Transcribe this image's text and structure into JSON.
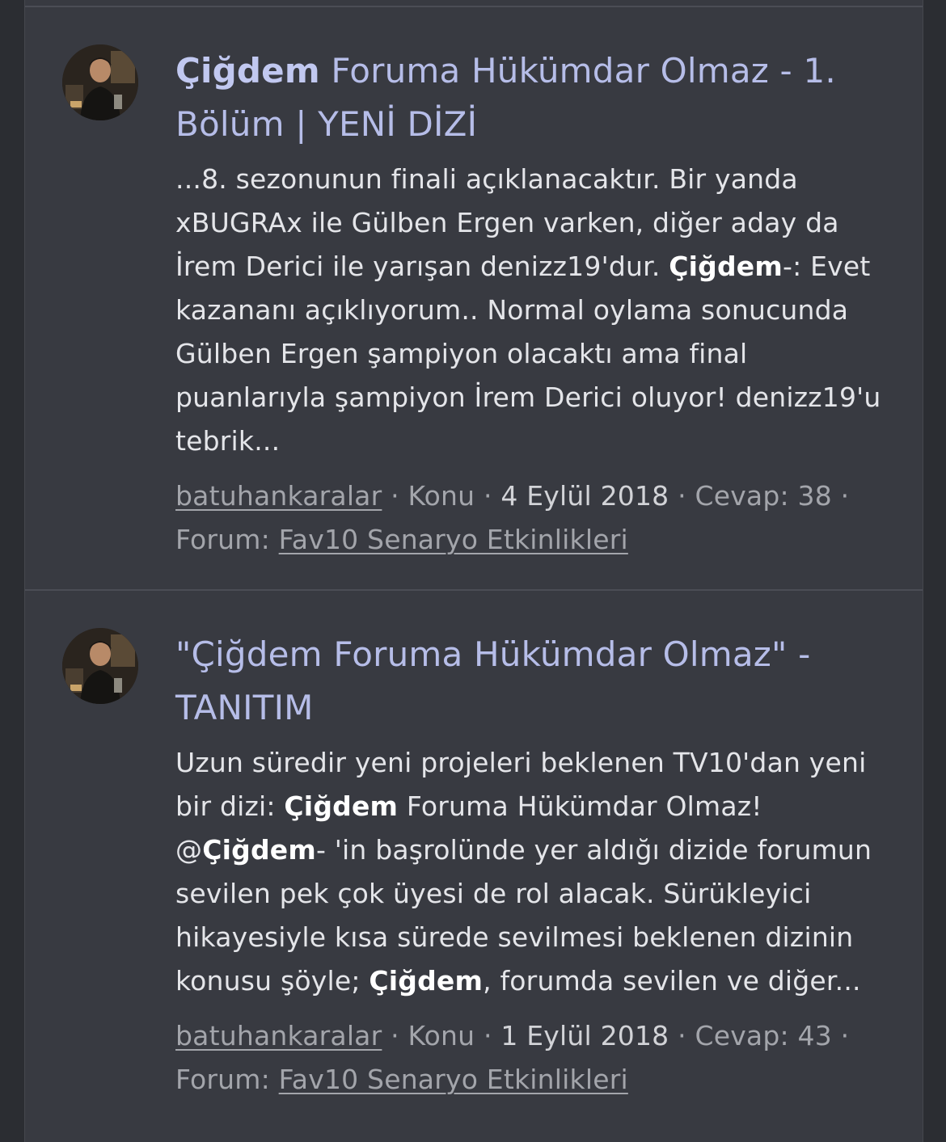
{
  "results": [
    {
      "title_highlight": "Çiğdem",
      "title_rest": " Foruma Hükümdar Olmaz - 1. Bölüm | YENİ DİZİ",
      "snippet_1": "...8. sezonunun finali açıklanacaktır. Bir yanda xBUGRAx ile Gülben Ergen varken, diğer aday da İrem Derici ile yarışan denizz19'dur. ",
      "snippet_highlight_1": "Çiğdem",
      "snippet_2": "-: Evet kazananı açıklıyorum.. Normal oylama sonucunda Gülben Ergen şampiyon olacaktı ama final puanlarıyla şampiyon İrem Derici oluyor! denizz19'u tebrik...",
      "author": "batuhankaralar",
      "type": "Konu",
      "date": "4 Eylül 2018",
      "replies_label": "Cevap:",
      "replies": "38",
      "forum_label": "Forum:",
      "forum": "Fav10 Senaryo Etkinlikleri",
      "separator": " · "
    },
    {
      "title_open_quote": "\"",
      "title_highlight": "Çiğdem",
      "title_rest": " Foruma Hükümdar Olmaz\" - TANITIM",
      "snippet_1": "Uzun süredir yeni projeleri beklenen TV10'dan yeni bir dizi: ",
      "snippet_highlight_1": "Çiğdem",
      "snippet_2": " Foruma Hükümdar Olmaz! @",
      "snippet_highlight_2": "Çiğdem",
      "snippet_3": "- 'in başrolünde yer aldığı dizide forumun sevilen pek çok üyesi de rol alacak. Sürükleyici hikayesiyle kısa sürede sevilmesi beklenen dizinin konusu şöyle; ",
      "snippet_highlight_3": "Çiğdem",
      "snippet_4": ", forumda sevilen ve diğer...",
      "author": "batuhankaralar",
      "type": "Konu",
      "date": "1 Eylül 2018",
      "replies_label": "Cevap:",
      "replies": "43",
      "forum_label": "Forum:",
      "forum": "Fav10 Senaryo Etkinlikleri",
      "separator": " · "
    }
  ],
  "avatar_icon": "user-avatar-photo"
}
